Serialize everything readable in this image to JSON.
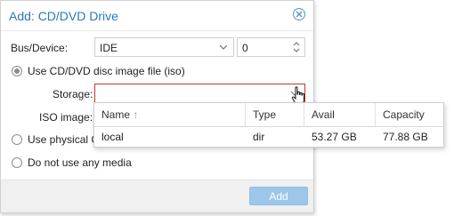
{
  "dialog": {
    "title": "Add: CD/DVD Drive",
    "bus_device_label": "Bus/Device:",
    "bus_value": "IDE",
    "device_value": "0",
    "option_iso_label": "Use CD/DVD disc image file (iso)",
    "storage_label": "Storage:",
    "storage_value": "",
    "iso_image_label": "ISO image:",
    "option_physical_label": "Use physical C",
    "option_none_label": "Do not use any media",
    "add_button": "Add"
  },
  "storage_dropdown": {
    "columns": [
      "Name",
      "Type",
      "Avail",
      "Capacity"
    ],
    "sort_indicator": "↑",
    "rows": [
      {
        "name": "local",
        "type": "dir",
        "avail": "53.27 GB",
        "capacity": "77.88 GB"
      }
    ]
  },
  "colors": {
    "title": "#2a78b8",
    "invalid_border": "#c0392b",
    "button_disabled": "#9cc7ea"
  }
}
